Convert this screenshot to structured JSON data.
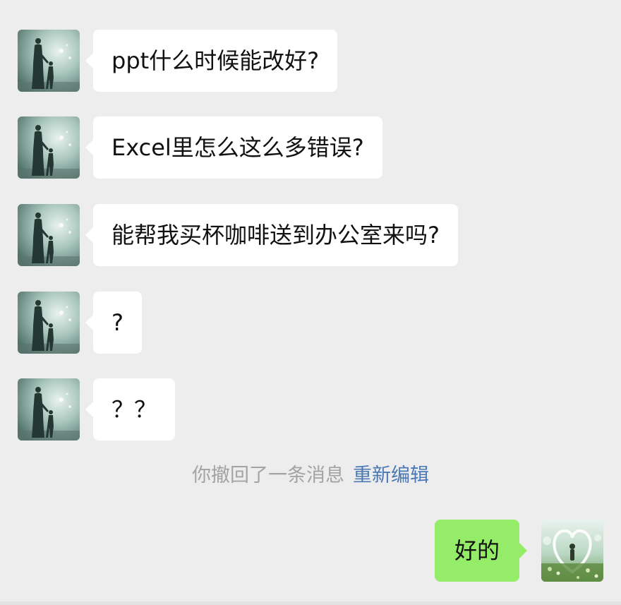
{
  "chat": {
    "messages": [
      {
        "sender": "contact",
        "text": "ppt什么时候能改好?"
      },
      {
        "sender": "contact",
        "text": "Excel里怎么这么多错误?"
      },
      {
        "sender": "contact",
        "text": "能帮我买杯咖啡送到办公室来吗?"
      },
      {
        "sender": "contact",
        "text": "?"
      },
      {
        "sender": "contact",
        "text": "？？"
      }
    ],
    "system_notice": {
      "text": "你撤回了一条消息",
      "action": "重新编辑"
    },
    "reply": {
      "sender": "me",
      "text": "好的"
    }
  },
  "colors": {
    "background": "#ededed",
    "incoming_bubble": "#ffffff",
    "outgoing_bubble": "#95ec69",
    "system_text": "#a3a3a3",
    "link": "#4a79b5"
  },
  "icons": {
    "contact_avatar": "silhouette-parent-child-avatar",
    "my_avatar": "garden-heart-avatar"
  }
}
